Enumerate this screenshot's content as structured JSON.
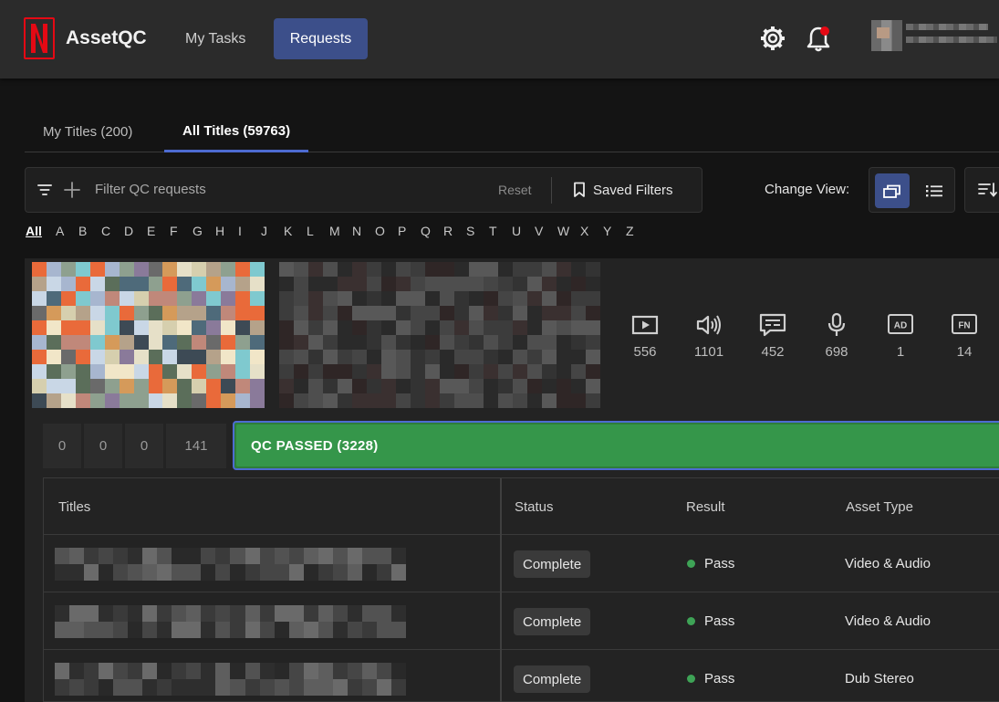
{
  "header": {
    "app_title": "AssetQC",
    "nav": [
      {
        "label": "My Tasks"
      },
      {
        "label": "Requests"
      }
    ],
    "notification_color": "#e50914"
  },
  "tabs": [
    {
      "label": "My Titles (200)"
    },
    {
      "label": "All Titles (59763)"
    }
  ],
  "filter": {
    "placeholder": "Filter QC requests",
    "reset_label": "Reset",
    "saved_filters_label": "Saved Filters"
  },
  "view": {
    "label": "Change View:"
  },
  "alphabet": [
    "All",
    "A",
    "B",
    "C",
    "D",
    "E",
    "F",
    "G",
    "H",
    "I",
    "J",
    "K",
    "L",
    "M",
    "N",
    "O",
    "P",
    "Q",
    "R",
    "S",
    "T",
    "U",
    "V",
    "W",
    "X",
    "Y",
    "Z"
  ],
  "stats": [
    {
      "icon": "video-icon",
      "value": "556"
    },
    {
      "icon": "audio-icon",
      "value": "1101"
    },
    {
      "icon": "subtitle-icon",
      "value": "452"
    },
    {
      "icon": "microphone-icon",
      "value": "698"
    },
    {
      "icon": "audio-description-icon",
      "value": "1"
    },
    {
      "icon": "forced-narrative-icon",
      "value": "14"
    }
  ],
  "counters": [
    "0",
    "0",
    "0",
    "141"
  ],
  "qc_status": {
    "label": "QC PASSED (3228)",
    "color": "#35964a"
  },
  "table": {
    "columns": [
      "Titles",
      "Status",
      "Result",
      "Asset Type"
    ],
    "rows": [
      {
        "status": "Complete",
        "result": "Pass",
        "asset_type": "Video & Audio"
      },
      {
        "status": "Complete",
        "result": "Pass",
        "asset_type": "Video & Audio"
      },
      {
        "status": "Complete",
        "result": "Pass",
        "asset_type": "Dub Stereo"
      }
    ]
  },
  "colors": {
    "accent": "#3c4f8a",
    "focus": "#4d6bd1",
    "pass": "#3ea356"
  }
}
